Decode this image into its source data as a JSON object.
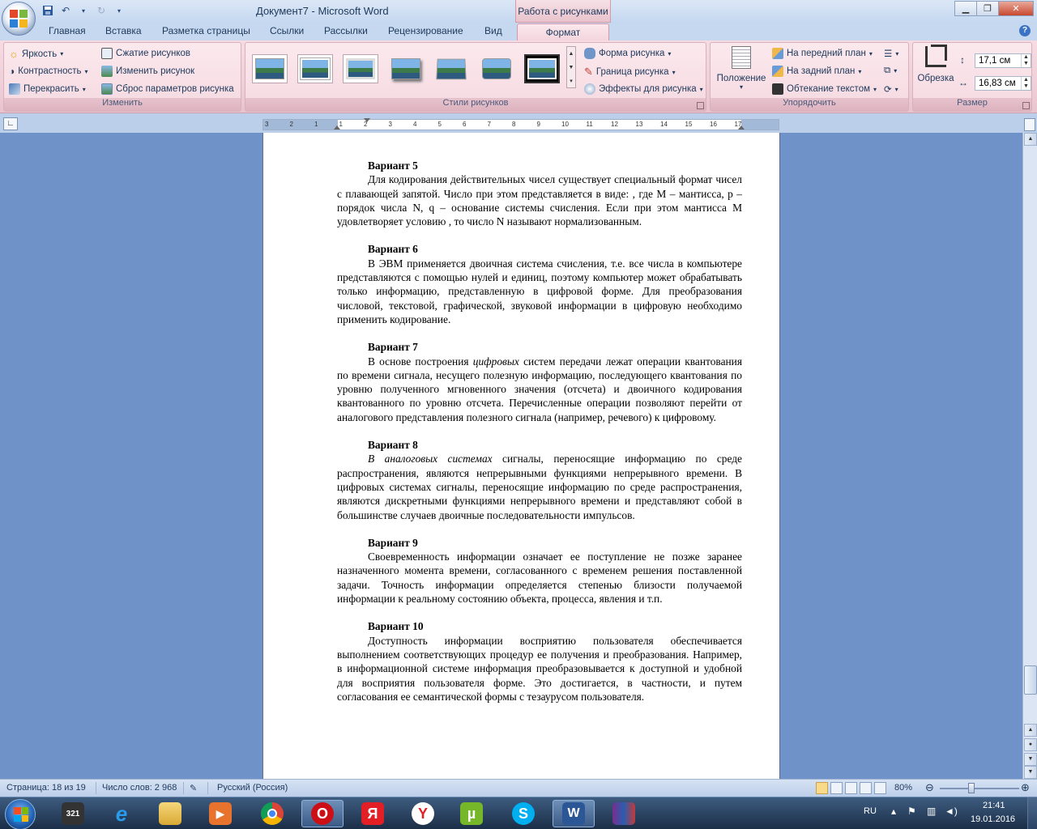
{
  "window": {
    "title": "Документ7 - Microsoft Word",
    "context_tab_header": "Работа с рисунками"
  },
  "tabs": [
    "Главная",
    "Вставка",
    "Разметка страницы",
    "Ссылки",
    "Рассылки",
    "Рецензирование",
    "Вид",
    "Формат"
  ],
  "active_tab": "Формат",
  "ribbon": {
    "change": {
      "brightness": "Яркость",
      "contrast": "Контрастность",
      "recolor": "Перекрасить",
      "compress": "Сжатие рисунков",
      "change_picture": "Изменить рисунок",
      "reset_picture": "Сброс параметров рисунка",
      "label": "Изменить"
    },
    "styles": {
      "shape": "Форма рисунка",
      "border": "Граница рисунка",
      "effects": "Эффекты для рисунка",
      "label": "Стили рисунков"
    },
    "arrange": {
      "position": "Положение",
      "bring_front": "На передний план",
      "send_back": "На задний план",
      "text_wrap": "Обтекание текстом",
      "label": "Упорядочить"
    },
    "size": {
      "crop": "Обрезка",
      "height": "17,1 см",
      "width": "16,83 см",
      "label": "Размер"
    }
  },
  "ruler": {
    "labels": [
      "3",
      "2",
      "1",
      "1",
      "2",
      "3",
      "4",
      "5",
      "6",
      "7",
      "8",
      "9",
      "10",
      "11",
      "12",
      "13",
      "14",
      "15",
      "16",
      "17"
    ]
  },
  "document": {
    "variants": [
      {
        "title": "Вариант  5",
        "text": "Для кодирования действительных чисел существует специальный формат чисел с плавающей запятой. Число при этом представляется в виде: , где M – мантисса, p – порядок числа N, q – основание системы счисления. Если при этом мантисса М удовлетворяет условию , то число N называют нормализованным."
      },
      {
        "title": "Вариант  6",
        "text": "В ЭВМ применяется двоичная система счисления, т.е. все числа в компьютере представляются с помощью нулей и единиц, поэтому компьютер может обрабатывать только информацию, представленную в цифровой форме. Для преобразования числовой, текстовой, графической, звуковой информации в цифровую необходимо применить кодирование."
      },
      {
        "title": "Вариант  7",
        "text_before": "В основе построения ",
        "text_italic": "цифровых",
        "text_after": " систем передачи лежат операции квантования по времени сигнала, несущего полезную информацию, последующего квантования по уровню полученного мгновенного значения (отсчета) и двоичного кодирования квантованного по уровню отсчета. Перечисленные операции позволяют перейти от аналогового представления полезного сигнала (например, речевого) к цифровому."
      },
      {
        "title": "Вариант  8",
        "text_italic": "В аналоговых системах",
        "text_after": " сигналы, переносящие информацию по среде распространения, являются непрерывными функциями непрерывного времени. В цифровых системах сигналы, переносящие информацию по среде распространения, являются дискретными функциями непрерывного времени и представляют собой в большинстве случаев двоичные последовательности импульсов."
      },
      {
        "title": "Вариант  9",
        "text": "Своевременность информации означает ее поступление не позже заранее назначенного момента времени, согласованного с временем решения поставленной задачи. Точность информации определяется степенью близости получаемой информации к реальному состоянию объекта, процесса, явления и т.п."
      },
      {
        "title": "Вариант  10",
        "text": "Доступность информации восприятию пользователя обеспечивается выполнением соответствующих процедур ее получения и преобразования. Например, в информационной системе информация преобразовывается к доступной и удобной для восприятия пользователя форме. Это достигается, в частности, и путем согласования ее семантической формы с тезаурусом пользователя."
      }
    ]
  },
  "status": {
    "page": "Страница: 18 из 19",
    "words": "Число слов: 2 968",
    "language": "Русский (Россия)",
    "zoom": "80%",
    "zoom_fraction": 0.4
  },
  "taskbar": {
    "lang": "RU",
    "time": "21:41",
    "date": "19.01.2016",
    "apps": [
      "media-player-321",
      "internet-explorer",
      "file-explorer",
      "video-player",
      "chrome",
      "opera",
      "yandex-browser",
      "yandex",
      "utorrent",
      "skype",
      "word",
      "winrar"
    ]
  },
  "colors": {
    "ribbon_pink": "#f5d9e0",
    "page_bg": "#ffffff",
    "workspace": "#6f93c9"
  }
}
